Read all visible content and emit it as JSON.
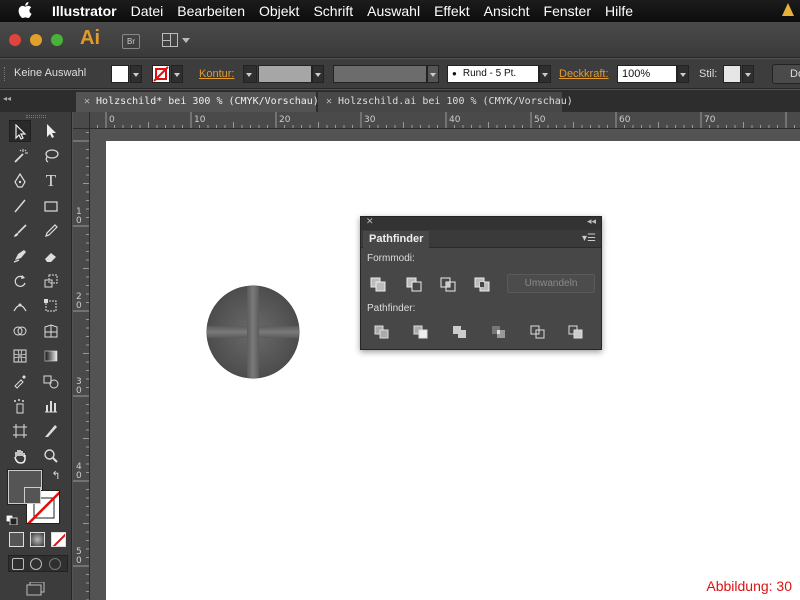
{
  "menubar": {
    "items": [
      "Illustrator",
      "Datei",
      "Bearbeiten",
      "Objekt",
      "Schrift",
      "Auswahl",
      "Effekt",
      "Ansicht",
      "Fenster",
      "Hilfe"
    ]
  },
  "appbar": {
    "logo": "Ai",
    "bridge": "Br"
  },
  "control": {
    "selection": "Keine Auswahl",
    "stroke_label": "Kontur:",
    "stroke_style": "Rund - 5 Pt.",
    "opacity_label": "Deckkraft:",
    "opacity_value": "100%",
    "style_label": "Stil:",
    "doc_button": "Do"
  },
  "tabs": [
    {
      "label": "Holzschild* bei 300 % (CMYK/Vorschau)",
      "active": true
    },
    {
      "label": "Holzschild.ai bei 100 % (CMYK/Vorschau)",
      "active": false
    }
  ],
  "ruler_top": [
    "0",
    "10",
    "20",
    "30",
    "40",
    "50",
    "60",
    "70"
  ],
  "ruler_left": [
    "1\n0",
    "2\n0",
    "3\n0",
    "4\n0",
    "5\n0"
  ],
  "pathfinder": {
    "title": "Pathfinder",
    "shape_modes_label": "Formmodi:",
    "expand_button": "Umwandeln",
    "pathfinders_label": "Pathfinder:"
  },
  "caption": "Abbildung: 30",
  "colors": {
    "accent": "#e39a2e",
    "caption": "#dd1111",
    "fill": "#555555"
  }
}
